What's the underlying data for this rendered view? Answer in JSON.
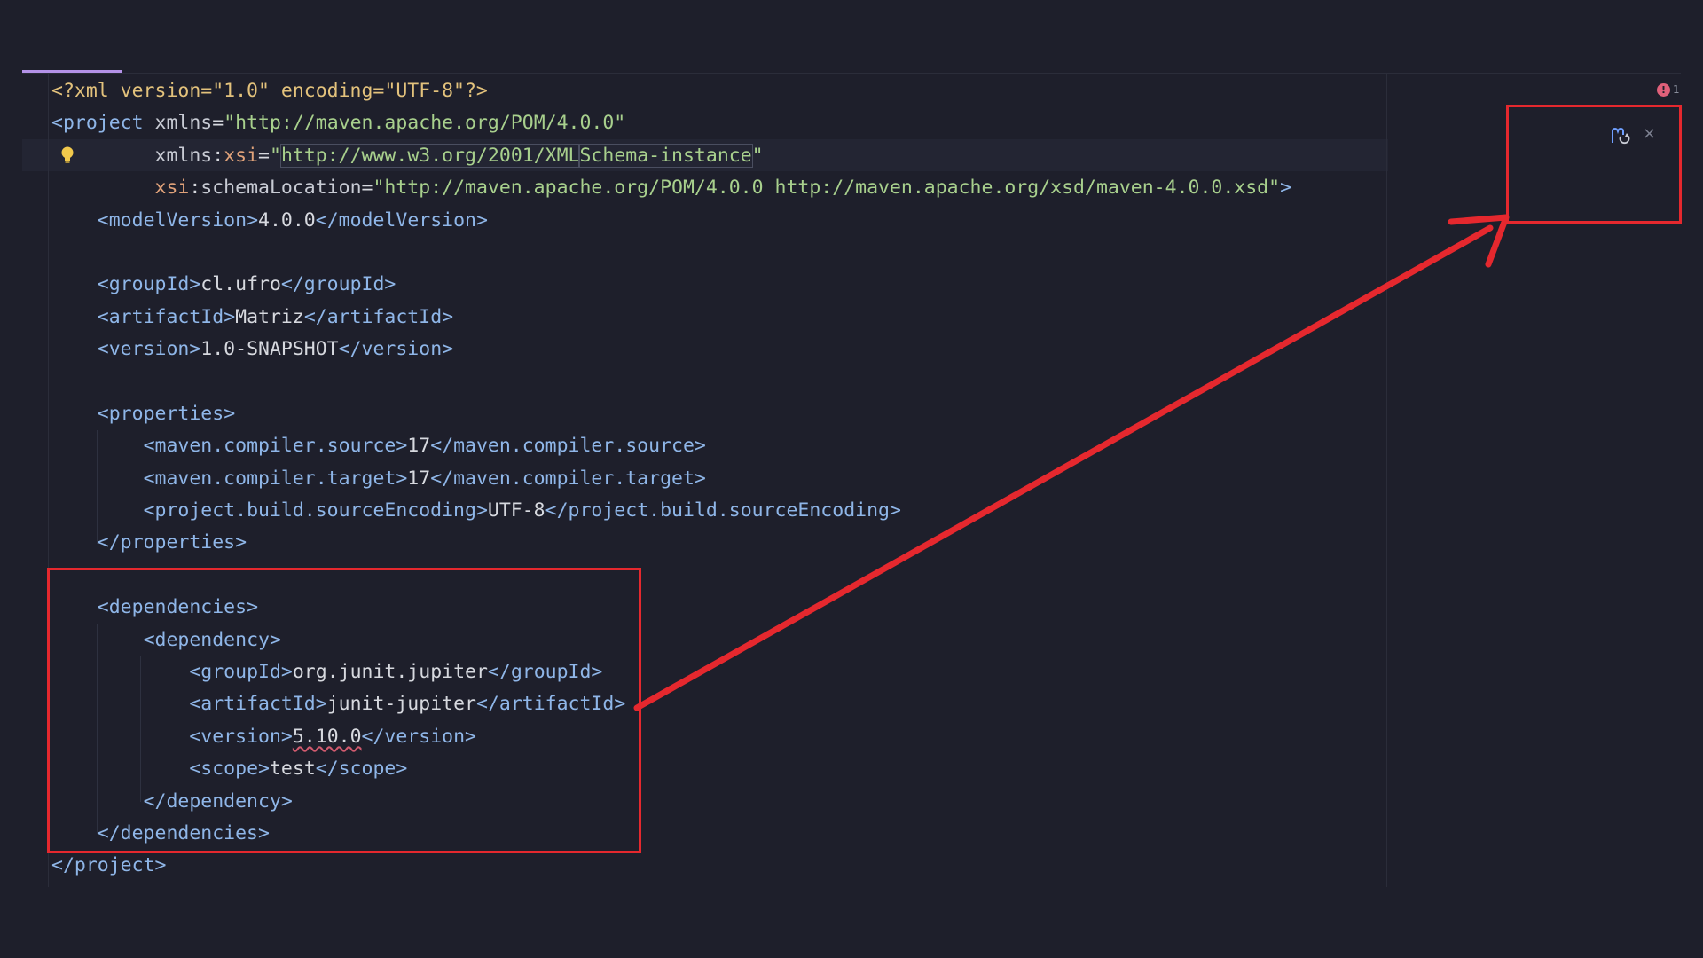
{
  "editor": {
    "error_count": "1",
    "lines": [
      {
        "segments": [
          {
            "c": "pi",
            "t": "<?xml version=\"1.0\" encoding=\"UTF-8\"?>"
          }
        ]
      },
      {
        "segments": [
          {
            "c": "br",
            "t": "<"
          },
          {
            "c": "tag",
            "t": "project "
          },
          {
            "c": "ns",
            "t": "xmlns"
          },
          {
            "c": "txt",
            "t": "="
          },
          {
            "c": "str",
            "t": "\"http://maven.apache.org/POM/4.0.0\""
          }
        ]
      },
      {
        "segments": [
          {
            "c": "txt",
            "t": "         "
          },
          {
            "c": "ns",
            "t": "xmlns"
          },
          {
            "c": "txt",
            "t": ":"
          },
          {
            "c": "attr",
            "t": "xsi"
          },
          {
            "c": "txt",
            "t": "="
          },
          {
            "c": "str",
            "t": "\""
          },
          {
            "c": "str url-box",
            "t": "http://www.w3.org/2001/XML"
          },
          {
            "c": "caret",
            "t": ""
          },
          {
            "c": "str url-box",
            "t": "Schema-instance"
          },
          {
            "c": "str",
            "t": "\""
          }
        ]
      },
      {
        "segments": [
          {
            "c": "txt",
            "t": "         "
          },
          {
            "c": "attr",
            "t": "xsi"
          },
          {
            "c": "txt",
            "t": ":"
          },
          {
            "c": "ns",
            "t": "schemaLocation"
          },
          {
            "c": "txt",
            "t": "="
          },
          {
            "c": "str",
            "t": "\"http://maven.apache.org/POM/4.0.0 http://maven.apache.org/xsd/maven-4.0.0.xsd\""
          },
          {
            "c": "br",
            "t": ">"
          }
        ]
      },
      {
        "segments": [
          {
            "c": "txt",
            "t": "    "
          },
          {
            "c": "br",
            "t": "<"
          },
          {
            "c": "tag",
            "t": "modelVersion"
          },
          {
            "c": "br",
            "t": ">"
          },
          {
            "c": "txt",
            "t": "4.0.0"
          },
          {
            "c": "br",
            "t": "</"
          },
          {
            "c": "tag",
            "t": "modelVersion"
          },
          {
            "c": "br",
            "t": ">"
          }
        ]
      },
      {
        "segments": []
      },
      {
        "segments": [
          {
            "c": "txt",
            "t": "    "
          },
          {
            "c": "br",
            "t": "<"
          },
          {
            "c": "tag",
            "t": "groupId"
          },
          {
            "c": "br",
            "t": ">"
          },
          {
            "c": "txt",
            "t": "cl.ufro"
          },
          {
            "c": "br",
            "t": "</"
          },
          {
            "c": "tag",
            "t": "groupId"
          },
          {
            "c": "br",
            "t": ">"
          }
        ]
      },
      {
        "segments": [
          {
            "c": "txt",
            "t": "    "
          },
          {
            "c": "br",
            "t": "<"
          },
          {
            "c": "tag",
            "t": "artifactId"
          },
          {
            "c": "br",
            "t": ">"
          },
          {
            "c": "txt",
            "t": "Matriz"
          },
          {
            "c": "br",
            "t": "</"
          },
          {
            "c": "tag",
            "t": "artifactId"
          },
          {
            "c": "br",
            "t": ">"
          }
        ]
      },
      {
        "segments": [
          {
            "c": "txt",
            "t": "    "
          },
          {
            "c": "br",
            "t": "<"
          },
          {
            "c": "tag",
            "t": "version"
          },
          {
            "c": "br",
            "t": ">"
          },
          {
            "c": "txt",
            "t": "1.0-SNAPSHOT"
          },
          {
            "c": "br",
            "t": "</"
          },
          {
            "c": "tag",
            "t": "version"
          },
          {
            "c": "br",
            "t": ">"
          }
        ]
      },
      {
        "segments": []
      },
      {
        "segments": [
          {
            "c": "txt",
            "t": "    "
          },
          {
            "c": "br",
            "t": "<"
          },
          {
            "c": "tag",
            "t": "properties"
          },
          {
            "c": "br",
            "t": ">"
          }
        ]
      },
      {
        "segments": [
          {
            "c": "txt",
            "t": "        "
          },
          {
            "c": "br",
            "t": "<"
          },
          {
            "c": "tag",
            "t": "maven.compiler.source"
          },
          {
            "c": "br",
            "t": ">"
          },
          {
            "c": "txt",
            "t": "17"
          },
          {
            "c": "br",
            "t": "</"
          },
          {
            "c": "tag",
            "t": "maven.compiler.source"
          },
          {
            "c": "br",
            "t": ">"
          }
        ]
      },
      {
        "segments": [
          {
            "c": "txt",
            "t": "        "
          },
          {
            "c": "br",
            "t": "<"
          },
          {
            "c": "tag",
            "t": "maven.compiler.target"
          },
          {
            "c": "br",
            "t": ">"
          },
          {
            "c": "txt",
            "t": "17"
          },
          {
            "c": "br",
            "t": "</"
          },
          {
            "c": "tag",
            "t": "maven.compiler.target"
          },
          {
            "c": "br",
            "t": ">"
          }
        ]
      },
      {
        "segments": [
          {
            "c": "txt",
            "t": "        "
          },
          {
            "c": "br",
            "t": "<"
          },
          {
            "c": "tag",
            "t": "project.build.sourceEncoding"
          },
          {
            "c": "br",
            "t": ">"
          },
          {
            "c": "txt",
            "t": "UTF-8"
          },
          {
            "c": "br",
            "t": "</"
          },
          {
            "c": "tag",
            "t": "project.build.sourceEncoding"
          },
          {
            "c": "br",
            "t": ">"
          }
        ]
      },
      {
        "segments": [
          {
            "c": "txt",
            "t": "    "
          },
          {
            "c": "br",
            "t": "</"
          },
          {
            "c": "tag",
            "t": "properties"
          },
          {
            "c": "br",
            "t": ">"
          }
        ]
      },
      {
        "segments": []
      },
      {
        "segments": [
          {
            "c": "txt",
            "t": "    "
          },
          {
            "c": "br",
            "t": "<"
          },
          {
            "c": "tag",
            "t": "dependencies"
          },
          {
            "c": "br",
            "t": ">"
          }
        ]
      },
      {
        "segments": [
          {
            "c": "txt",
            "t": "        "
          },
          {
            "c": "br",
            "t": "<"
          },
          {
            "c": "tag",
            "t": "dependency"
          },
          {
            "c": "br",
            "t": ">"
          }
        ]
      },
      {
        "segments": [
          {
            "c": "txt",
            "t": "            "
          },
          {
            "c": "br",
            "t": "<"
          },
          {
            "c": "tag",
            "t": "groupId"
          },
          {
            "c": "br",
            "t": ">"
          },
          {
            "c": "txt",
            "t": "org.junit.jupiter"
          },
          {
            "c": "br",
            "t": "</"
          },
          {
            "c": "tag",
            "t": "groupId"
          },
          {
            "c": "br",
            "t": ">"
          }
        ]
      },
      {
        "segments": [
          {
            "c": "txt",
            "t": "            "
          },
          {
            "c": "br",
            "t": "<"
          },
          {
            "c": "tag",
            "t": "artifactId"
          },
          {
            "c": "br",
            "t": ">"
          },
          {
            "c": "txt",
            "t": "junit-jupiter"
          },
          {
            "c": "br",
            "t": "</"
          },
          {
            "c": "tag",
            "t": "artifactId"
          },
          {
            "c": "br",
            "t": ">"
          }
        ]
      },
      {
        "segments": [
          {
            "c": "txt",
            "t": "            "
          },
          {
            "c": "br",
            "t": "<"
          },
          {
            "c": "tag",
            "t": "version"
          },
          {
            "c": "br",
            "t": ">"
          },
          {
            "c": "txt squiggle",
            "t": "5.10.0"
          },
          {
            "c": "br",
            "t": "</"
          },
          {
            "c": "tag",
            "t": "version"
          },
          {
            "c": "br",
            "t": ">"
          }
        ]
      },
      {
        "segments": [
          {
            "c": "txt",
            "t": "            "
          },
          {
            "c": "br",
            "t": "<"
          },
          {
            "c": "tag",
            "t": "scope"
          },
          {
            "c": "br",
            "t": ">"
          },
          {
            "c": "txt",
            "t": "test"
          },
          {
            "c": "br",
            "t": "</"
          },
          {
            "c": "tag",
            "t": "scope"
          },
          {
            "c": "br",
            "t": ">"
          }
        ]
      },
      {
        "segments": [
          {
            "c": "txt",
            "t": "        "
          },
          {
            "c": "br",
            "t": "</"
          },
          {
            "c": "tag",
            "t": "dependency"
          },
          {
            "c": "br",
            "t": ">"
          }
        ]
      },
      {
        "segments": [
          {
            "c": "txt",
            "t": "    "
          },
          {
            "c": "br",
            "t": "</"
          },
          {
            "c": "tag",
            "t": "dependencies"
          },
          {
            "c": "br",
            "t": ">"
          }
        ]
      },
      {
        "segments": [
          {
            "c": "br",
            "t": "</"
          },
          {
            "c": "tag",
            "t": "project"
          },
          {
            "c": "br",
            "t": ">"
          }
        ]
      }
    ]
  },
  "icons": {
    "bulb": "lightbulb-icon",
    "error": "error-icon",
    "maven": "maven-reload-icon",
    "close": "close-icon"
  },
  "close_glyph": "×",
  "error_glyph": "!",
  "colors": {
    "annotation": "#e5282e",
    "background": "#1e1f2b"
  }
}
